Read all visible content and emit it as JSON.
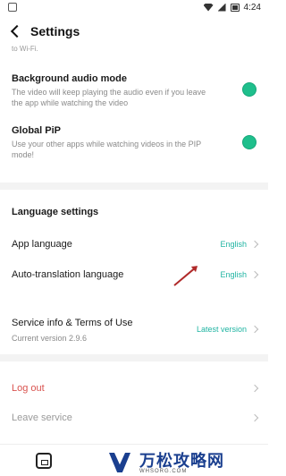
{
  "status_bar": {
    "time": "4:24"
  },
  "header": {
    "title": "Settings"
  },
  "cut_text": "to Wi-Fi.",
  "toggles": [
    {
      "title": "Background audio mode",
      "description": "The video will keep playing the audio even if you leave the app while watching the video",
      "on": true
    },
    {
      "title": "Global PiP",
      "description": "Use your other apps while watching videos in the PIP mode!",
      "on": true
    }
  ],
  "language": {
    "section_title": "Language settings",
    "app_language_label": "App language",
    "app_language_value": "English",
    "auto_translation_label": "Auto-translation language",
    "auto_translation_value": "English"
  },
  "service": {
    "label": "Service info & Terms of Use",
    "sub": "Current version 2.9.6",
    "value": "Latest version"
  },
  "account": {
    "logout": "Log out",
    "leave": "Leave service"
  },
  "watermark": {
    "name": "万松攻略网",
    "url": "WHSORG.COM"
  },
  "colors": {
    "accent": "#1fb4a2",
    "toggle": "#1fbf8c",
    "logout": "#d9534f",
    "annotation_arrow": "#b02a2a"
  }
}
